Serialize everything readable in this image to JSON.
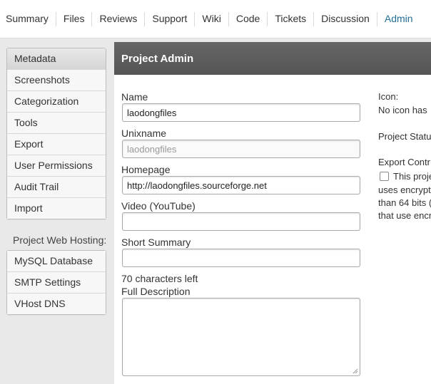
{
  "nav": {
    "tabs": [
      "Summary",
      "Files",
      "Reviews",
      "Support",
      "Wiki",
      "Code",
      "Tickets",
      "Discussion",
      "Admin"
    ],
    "active": "Admin"
  },
  "sidebar": {
    "items": [
      "Metadata",
      "Screenshots",
      "Categorization",
      "Tools",
      "Export",
      "User Permissions",
      "Audit Trail",
      "Import"
    ],
    "hosting_heading": "Project Web Hosting:",
    "hosting_items": [
      "MySQL Database",
      "SMTP Settings",
      "VHost DNS"
    ]
  },
  "panel": {
    "title": "Project Admin",
    "name_label": "Name",
    "name_value": "laodongfiles",
    "unixname_label": "Unixname",
    "unixname_value": "laodongfiles",
    "homepage_label": "Homepage",
    "homepage_value": "http://laodongfiles.sourceforge.net",
    "video_label": "Video (YouTube)",
    "video_value": "",
    "summary_label": "Short Summary",
    "summary_value": "",
    "chars_left": "70 characters left",
    "description_label": "Full Description",
    "icon_label": "Icon:",
    "icon_text": "No icon has",
    "status_label": "Project Statu",
    "export_label": "Export Contr",
    "export_line1": "This proje",
    "export_line2": "uses encrypt",
    "export_line3": "than 64 bits (",
    "export_line4": "that use encr"
  }
}
